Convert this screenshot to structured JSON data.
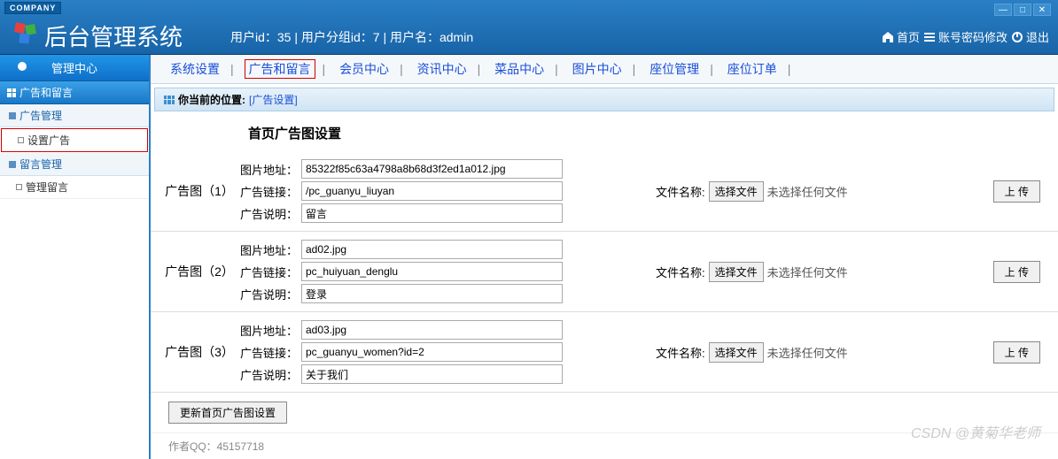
{
  "header": {
    "company_tag": "COMPANY",
    "title": "后台管理系统",
    "user_info": "用户id：35 | 用户分组id：7 | 用户名：admin",
    "actions": {
      "home": "首页",
      "password": "账号密码修改",
      "logout": "退出"
    }
  },
  "sidebar": {
    "title": "管理中心",
    "category": "广告和留言",
    "groups": [
      {
        "header": "广告管理",
        "items": [
          {
            "label": "设置广告",
            "highlight": true
          }
        ]
      },
      {
        "header": "留言管理",
        "items": [
          {
            "label": "管理留言",
            "highlight": false
          }
        ]
      }
    ]
  },
  "topnav": {
    "items": [
      {
        "label": "系统设置"
      },
      {
        "label": "广告和留言",
        "highlight": true
      },
      {
        "label": "会员中心"
      },
      {
        "label": "资讯中心"
      },
      {
        "label": "菜品中心"
      },
      {
        "label": "图片中心"
      },
      {
        "label": "座位管理"
      },
      {
        "label": "座位订单"
      }
    ]
  },
  "breadcrumb": {
    "prefix": "你当前的位置:",
    "current": "[广告设置]"
  },
  "page_title": "首页广告图设置",
  "labels": {
    "img_addr": "图片地址：",
    "ad_link": "广告链接：",
    "ad_desc": "广告说明：",
    "file_name": "文件名称:",
    "choose_file": "选择文件",
    "no_file": "未选择任何文件",
    "upload": "上 传",
    "submit": "更新首页广告图设置"
  },
  "ads": [
    {
      "label": "广告图（1）",
      "img": "85322f85c63a4798a8b68d3f2ed1a012.jpg",
      "link": "/pc_guanyu_liuyan",
      "desc": "留言"
    },
    {
      "label": "广告图（2）",
      "img": "ad02.jpg",
      "link": "pc_huiyuan_denglu",
      "desc": "登录"
    },
    {
      "label": "广告图（3）",
      "img": "ad03.jpg",
      "link": "pc_guanyu_women?id=2",
      "desc": "关于我们"
    }
  ],
  "footer": {
    "author": "作者QQ：45157718",
    "watermark": "CSDN @黄菊华老师"
  }
}
